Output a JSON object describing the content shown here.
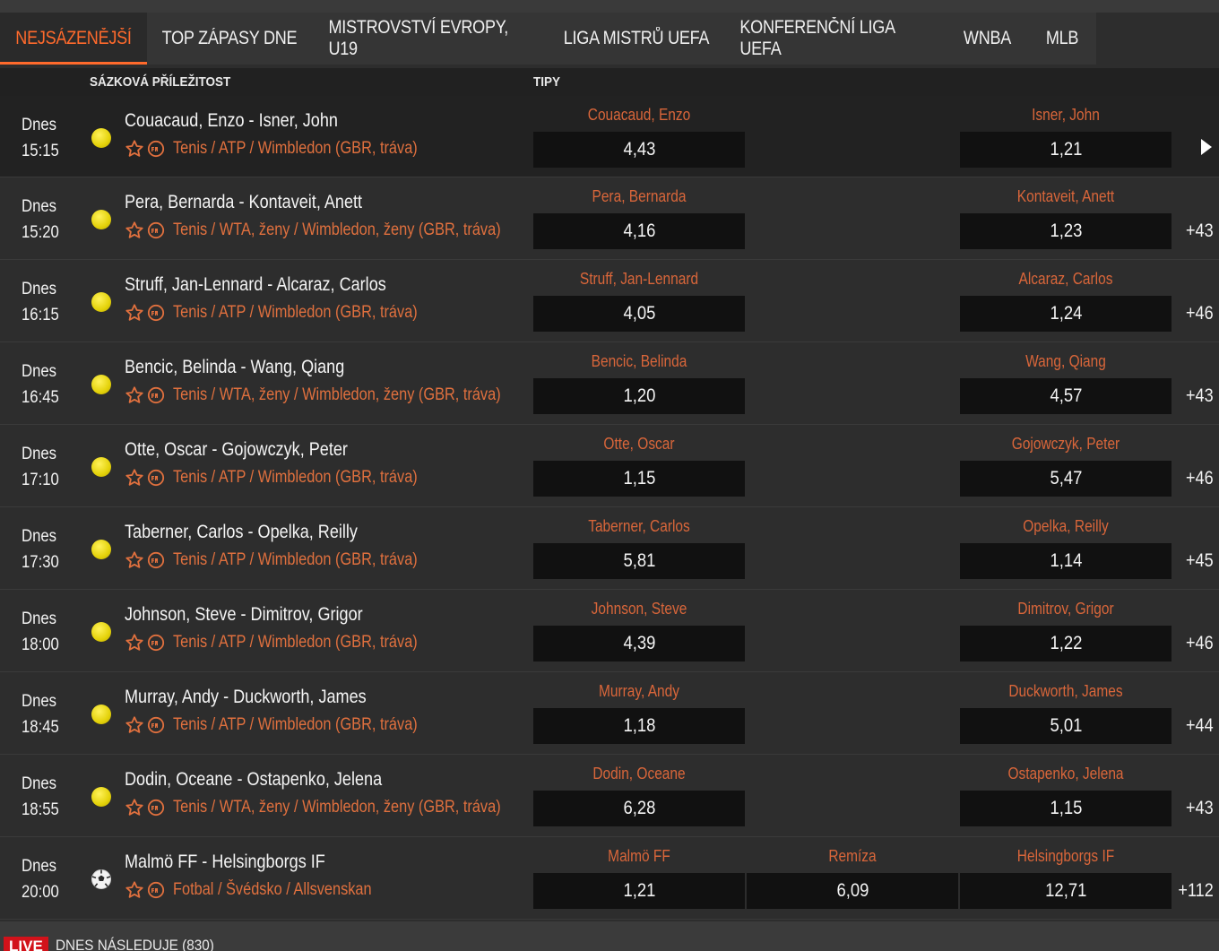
{
  "tabs": [
    {
      "label": "NEJSÁZENĚJŠÍ",
      "active": true
    },
    {
      "label": "TOP ZÁPASY DNE",
      "active": false
    },
    {
      "label": "MISTROVSTVÍ EVROPY, U19",
      "active": false
    },
    {
      "label": "LIGA MISTRŮ UEFA",
      "active": false
    },
    {
      "label": "KONFERENČNÍ LIGA UEFA",
      "active": false
    },
    {
      "label": "WNBA",
      "active": false
    },
    {
      "label": "MLB",
      "active": false
    }
  ],
  "header": {
    "opportunity": "SÁZKOVÁ PŘÍLEŽITOST",
    "tips": "TIPY"
  },
  "accent_color": "#ff6a2c",
  "events": [
    {
      "day": "Dnes",
      "time": "15:15",
      "sport": "tennis-ball-icon",
      "name": "Couacaud, Enzo - Isner, John",
      "category": "Tenis / ATP / Wimbledon (GBR, tráva)",
      "home": "Couacaud, Enzo",
      "home_odd": "4,43",
      "away": "Isner, John",
      "away_odd": "1,21",
      "more": ""
    },
    {
      "day": "Dnes",
      "time": "15:20",
      "sport": "tennis-ball-icon",
      "name": "Pera, Bernarda - Kontaveit, Anett",
      "category": "Tenis / WTA, ženy / Wimbledon, ženy (GBR, tráva)",
      "home": "Pera, Bernarda",
      "home_odd": "4,16",
      "away": "Kontaveit, Anett",
      "away_odd": "1,23",
      "more": "+43"
    },
    {
      "day": "Dnes",
      "time": "16:15",
      "sport": "tennis-ball-icon",
      "name": "Struff, Jan-Lennard - Alcaraz, Carlos",
      "category": "Tenis / ATP / Wimbledon (GBR, tráva)",
      "home": "Struff, Jan-Lennard",
      "home_odd": "4,05",
      "away": "Alcaraz, Carlos",
      "away_odd": "1,24",
      "more": "+46"
    },
    {
      "day": "Dnes",
      "time": "16:45",
      "sport": "tennis-ball-icon",
      "name": "Bencic, Belinda - Wang, Qiang",
      "category": "Tenis / WTA, ženy / Wimbledon, ženy (GBR, tráva)",
      "home": "Bencic, Belinda",
      "home_odd": "1,20",
      "away": "Wang, Qiang",
      "away_odd": "4,57",
      "more": "+43"
    },
    {
      "day": "Dnes",
      "time": "17:10",
      "sport": "tennis-ball-icon",
      "name": "Otte, Oscar - Gojowczyk, Peter",
      "category": "Tenis / ATP / Wimbledon (GBR, tráva)",
      "home": "Otte, Oscar",
      "home_odd": "1,15",
      "away": "Gojowczyk, Peter",
      "away_odd": "5,47",
      "more": "+46"
    },
    {
      "day": "Dnes",
      "time": "17:30",
      "sport": "tennis-ball-icon",
      "name": "Taberner, Carlos - Opelka, Reilly",
      "category": "Tenis / ATP / Wimbledon (GBR, tráva)",
      "home": "Taberner, Carlos",
      "home_odd": "5,81",
      "away": "Opelka, Reilly",
      "away_odd": "1,14",
      "more": "+45"
    },
    {
      "day": "Dnes",
      "time": "18:00",
      "sport": "tennis-ball-icon",
      "name": "Johnson, Steve - Dimitrov, Grigor",
      "category": "Tenis / ATP / Wimbledon (GBR, tráva)",
      "home": "Johnson, Steve",
      "home_odd": "4,39",
      "away": "Dimitrov, Grigor",
      "away_odd": "1,22",
      "more": "+46"
    },
    {
      "day": "Dnes",
      "time": "18:45",
      "sport": "tennis-ball-icon",
      "name": "Murray, Andy - Duckworth, James",
      "category": "Tenis / ATP / Wimbledon (GBR, tráva)",
      "home": "Murray, Andy",
      "home_odd": "1,18",
      "away": "Duckworth, James",
      "away_odd": "5,01",
      "more": "+44"
    },
    {
      "day": "Dnes",
      "time": "18:55",
      "sport": "tennis-ball-icon",
      "name": "Dodin, Oceane - Ostapenko, Jelena",
      "category": "Tenis / WTA, ženy / Wimbledon, ženy (GBR, tráva)",
      "home": "Dodin, Oceane",
      "home_odd": "6,28",
      "away": "Ostapenko, Jelena",
      "away_odd": "1,15",
      "more": "+43"
    },
    {
      "day": "Dnes",
      "time": "20:00",
      "sport": "soccer-ball-icon",
      "name": "Malmö FF - Helsingborgs IF",
      "category": "Fotbal / Švédsko / Allsvenskan",
      "home": "Malmö FF",
      "home_odd": "1,21",
      "draw": "Remíza",
      "draw_odd": "6,09",
      "away": "Helsingborgs IF",
      "away_odd": "12,71",
      "more": "+112"
    }
  ],
  "live": {
    "badge": "LIVE",
    "text": "DNES NÁSLEDUJE (830)"
  }
}
